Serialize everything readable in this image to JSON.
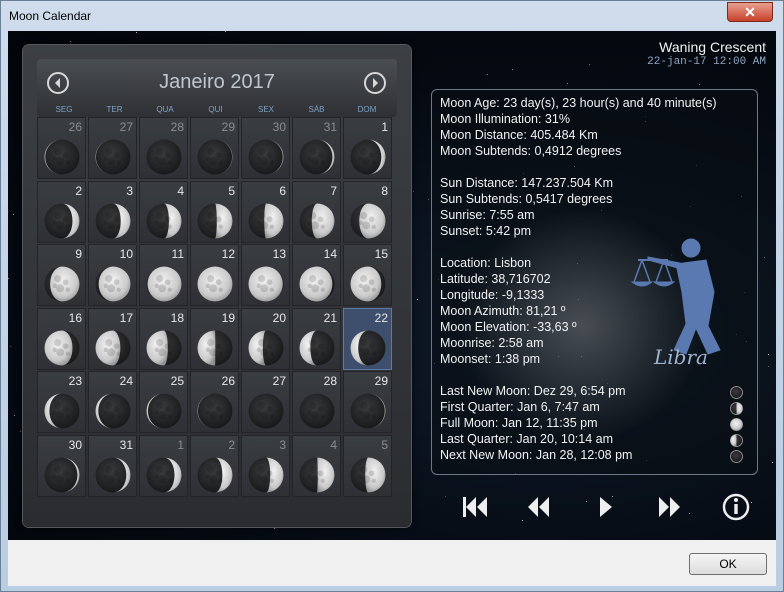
{
  "window": {
    "title": "Moon Calendar",
    "close_glyph": "✕"
  },
  "calendar": {
    "month_label": "Janeiro 2017",
    "weekdays": [
      "SEG",
      "TER",
      "QUA",
      "QUI",
      "SEX",
      "SÁB",
      "DOM"
    ],
    "days": [
      {
        "d": "26",
        "other": true,
        "ill": 0.02,
        "wax": false
      },
      {
        "d": "27",
        "other": true,
        "ill": 0.01,
        "wax": false
      },
      {
        "d": "28",
        "other": true,
        "ill": 0.0,
        "wax": true
      },
      {
        "d": "29",
        "other": true,
        "ill": 0.01,
        "wax": true
      },
      {
        "d": "30",
        "other": true,
        "ill": 0.02,
        "wax": true
      },
      {
        "d": "31",
        "other": true,
        "ill": 0.06,
        "wax": true
      },
      {
        "d": "1",
        "other": false,
        "ill": 0.12,
        "wax": true
      },
      {
        "d": "2",
        "other": false,
        "ill": 0.2,
        "wax": true
      },
      {
        "d": "3",
        "other": false,
        "ill": 0.28,
        "wax": true
      },
      {
        "d": "4",
        "other": false,
        "ill": 0.36,
        "wax": true
      },
      {
        "d": "5",
        "other": false,
        "ill": 0.45,
        "wax": true
      },
      {
        "d": "6",
        "other": false,
        "ill": 0.55,
        "wax": true
      },
      {
        "d": "7",
        "other": false,
        "ill": 0.65,
        "wax": true
      },
      {
        "d": "8",
        "other": false,
        "ill": 0.75,
        "wax": true
      },
      {
        "d": "9",
        "other": false,
        "ill": 0.84,
        "wax": true
      },
      {
        "d": "10",
        "other": false,
        "ill": 0.91,
        "wax": true
      },
      {
        "d": "11",
        "other": false,
        "ill": 0.97,
        "wax": true
      },
      {
        "d": "12",
        "other": false,
        "ill": 1.0,
        "wax": true
      },
      {
        "d": "13",
        "other": false,
        "ill": 0.98,
        "wax": false
      },
      {
        "d": "14",
        "other": false,
        "ill": 0.94,
        "wax": false
      },
      {
        "d": "15",
        "other": false,
        "ill": 0.88,
        "wax": false
      },
      {
        "d": "16",
        "other": false,
        "ill": 0.8,
        "wax": false
      },
      {
        "d": "17",
        "other": false,
        "ill": 0.71,
        "wax": false
      },
      {
        "d": "18",
        "other": false,
        "ill": 0.61,
        "wax": false
      },
      {
        "d": "19",
        "other": false,
        "ill": 0.51,
        "wax": false
      },
      {
        "d": "20",
        "other": false,
        "ill": 0.41,
        "wax": false
      },
      {
        "d": "21",
        "other": false,
        "ill": 0.31,
        "wax": false
      },
      {
        "d": "22",
        "other": false,
        "ill": 0.22,
        "wax": false,
        "selected": true
      },
      {
        "d": "23",
        "other": false,
        "ill": 0.14,
        "wax": false
      },
      {
        "d": "24",
        "other": false,
        "ill": 0.08,
        "wax": false
      },
      {
        "d": "25",
        "other": false,
        "ill": 0.04,
        "wax": false
      },
      {
        "d": "26",
        "other": false,
        "ill": 0.01,
        "wax": false
      },
      {
        "d": "27",
        "other": false,
        "ill": 0.0,
        "wax": false
      },
      {
        "d": "28",
        "other": false,
        "ill": 0.0,
        "wax": true
      },
      {
        "d": "29",
        "other": false,
        "ill": 0.02,
        "wax": true
      },
      {
        "d": "30",
        "other": false,
        "ill": 0.06,
        "wax": true
      },
      {
        "d": "31",
        "other": false,
        "ill": 0.12,
        "wax": true
      },
      {
        "d": "1",
        "other": true,
        "ill": 0.2,
        "wax": true
      },
      {
        "d": "2",
        "other": true,
        "ill": 0.29,
        "wax": true
      },
      {
        "d": "3",
        "other": true,
        "ill": 0.38,
        "wax": true
      },
      {
        "d": "4",
        "other": true,
        "ill": 0.48,
        "wax": true
      },
      {
        "d": "5",
        "other": true,
        "ill": 0.58,
        "wax": true
      }
    ]
  },
  "phase": {
    "name": "Waning Crescent",
    "datetime": "22-jan-17 12:00 AM"
  },
  "info": {
    "lines": [
      "Moon Age: 23 day(s), 23 hour(s) and 40 minute(s)",
      "Moon Illumination: 31%",
      "Moon Distance: 405.484 Km",
      "Moon Subtends: 0,4912 degrees",
      "",
      "Sun Distance:  147.237.504 Km",
      "Sun Subtends: 0,5417 degrees",
      "Sunrise: 7:55 am",
      "Sunset: 5:42 pm",
      "",
      "Location: Lisbon",
      "Latitude: 38,716702",
      "Longitude: -9,1333",
      "Moon Azimuth: 81,21 º",
      "Moon Elevation: -33,63 º",
      "Moonrise: 2:58 am",
      "Moonset: 1:38 pm",
      ""
    ],
    "events": [
      {
        "text": "Last New Moon: Dez 29, 6:54 pm",
        "icon": "new-moon-icon",
        "ill": 0.0,
        "wax": true
      },
      {
        "text": "First Quarter: Jan 6, 7:47 am",
        "icon": "first-quarter-icon",
        "ill": 0.5,
        "wax": true
      },
      {
        "text": "Full Moon: Jan 12, 11:35 pm",
        "icon": "full-moon-icon",
        "ill": 1.0,
        "wax": true
      },
      {
        "text": "Last Quarter: Jan 20, 10:14 am",
        "icon": "last-quarter-icon",
        "ill": 0.5,
        "wax": false
      },
      {
        "text": "Next New Moon: Jan 28, 12:08 pm",
        "icon": "new-moon-icon",
        "ill": 0.0,
        "wax": true
      }
    ],
    "zodiac": {
      "label": "Libra",
      "icon": "libra-icon"
    }
  },
  "controls": [
    "skip-back-icon",
    "rewind-icon",
    "play-icon",
    "fast-forward-icon",
    "info-icon"
  ],
  "footer": {
    "ok_label": "OK"
  },
  "colors": {
    "accent": "#7fa2c6",
    "selected": "#3d4f6c",
    "zodiac": "#5a79b0"
  }
}
